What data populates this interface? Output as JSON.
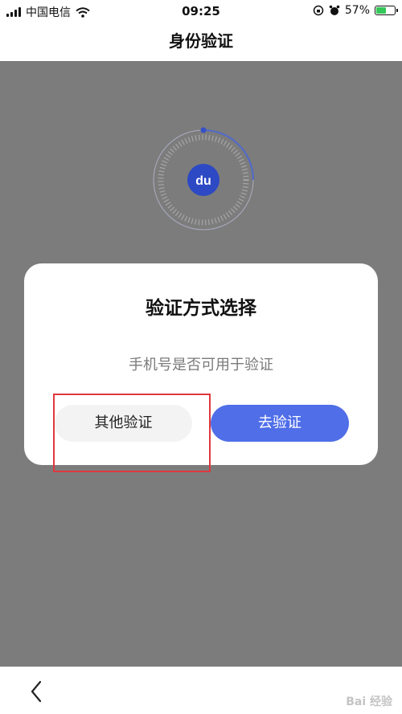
{
  "status_bar": {
    "carrier": "中国电信",
    "time": "09:25",
    "battery_text": "57%",
    "battery_level": 0.57
  },
  "header": {
    "title": "身份验证"
  },
  "logo": {
    "text": "du"
  },
  "dialog": {
    "title": "验证方式选择",
    "message": "手机号是否可用于验证",
    "secondary_button": "其他验证",
    "primary_button": "去验证"
  },
  "watermark": {
    "text": "Bai 经验"
  },
  "colors": {
    "primary": "#4f6ee8",
    "overlay": "#7c7c7c",
    "highlight": "#e0383e",
    "battery": "#34c759"
  }
}
